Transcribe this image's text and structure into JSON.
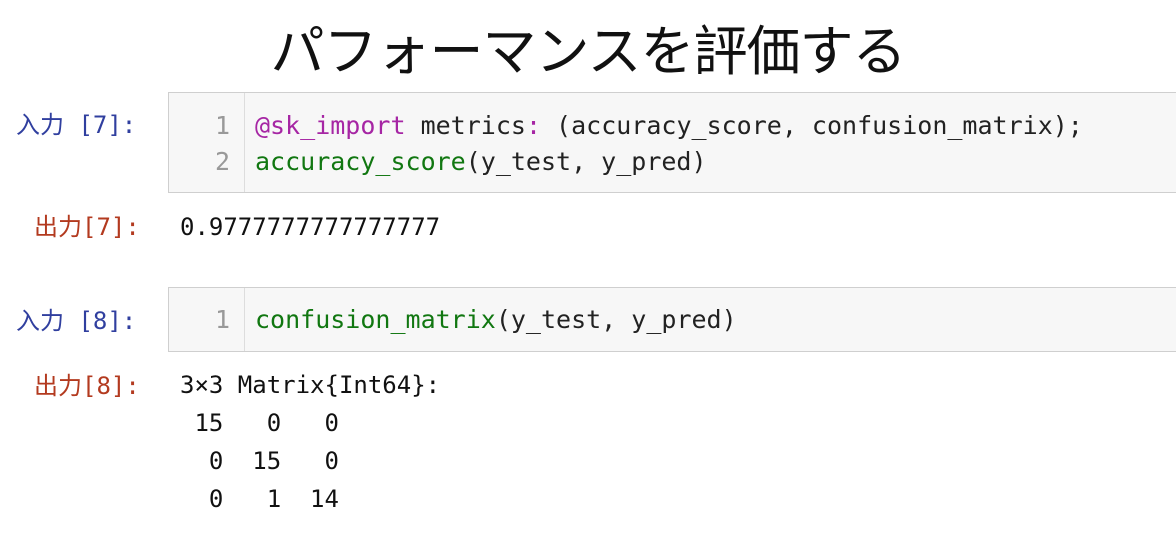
{
  "title": "パフォーマンスを評価する",
  "cells": [
    {
      "in_prompt": "入力 [7]:",
      "lines": [
        {
          "num": "1",
          "segments": [
            {
              "text": "@sk_import",
              "style": "purple"
            },
            {
              "text": " metrics",
              "style": "plain"
            },
            {
              "text": ":",
              "style": "purple"
            },
            {
              "text": " (accuracy_score, confusion_matrix);",
              "style": "plain"
            }
          ]
        },
        {
          "num": "2",
          "segments": [
            {
              "text": "accuracy_score",
              "style": "green"
            },
            {
              "text": "(y_test, y_pred)",
              "style": "plain"
            }
          ]
        }
      ],
      "out_prompt": "出力[7]:",
      "output_lines": [
        "0.9777777777777777"
      ]
    },
    {
      "in_prompt": "入力 [8]:",
      "lines": [
        {
          "num": "1",
          "segments": [
            {
              "text": "confusion_matrix",
              "style": "green"
            },
            {
              "text": "(y_test, y_pred)",
              "style": "plain"
            }
          ]
        }
      ],
      "out_prompt": "出力[8]:",
      "output_lines": [
        "3×3 Matrix{Int64}:",
        " 15   0   0",
        "  0  15   0",
        "  0   1  14"
      ]
    }
  ]
}
